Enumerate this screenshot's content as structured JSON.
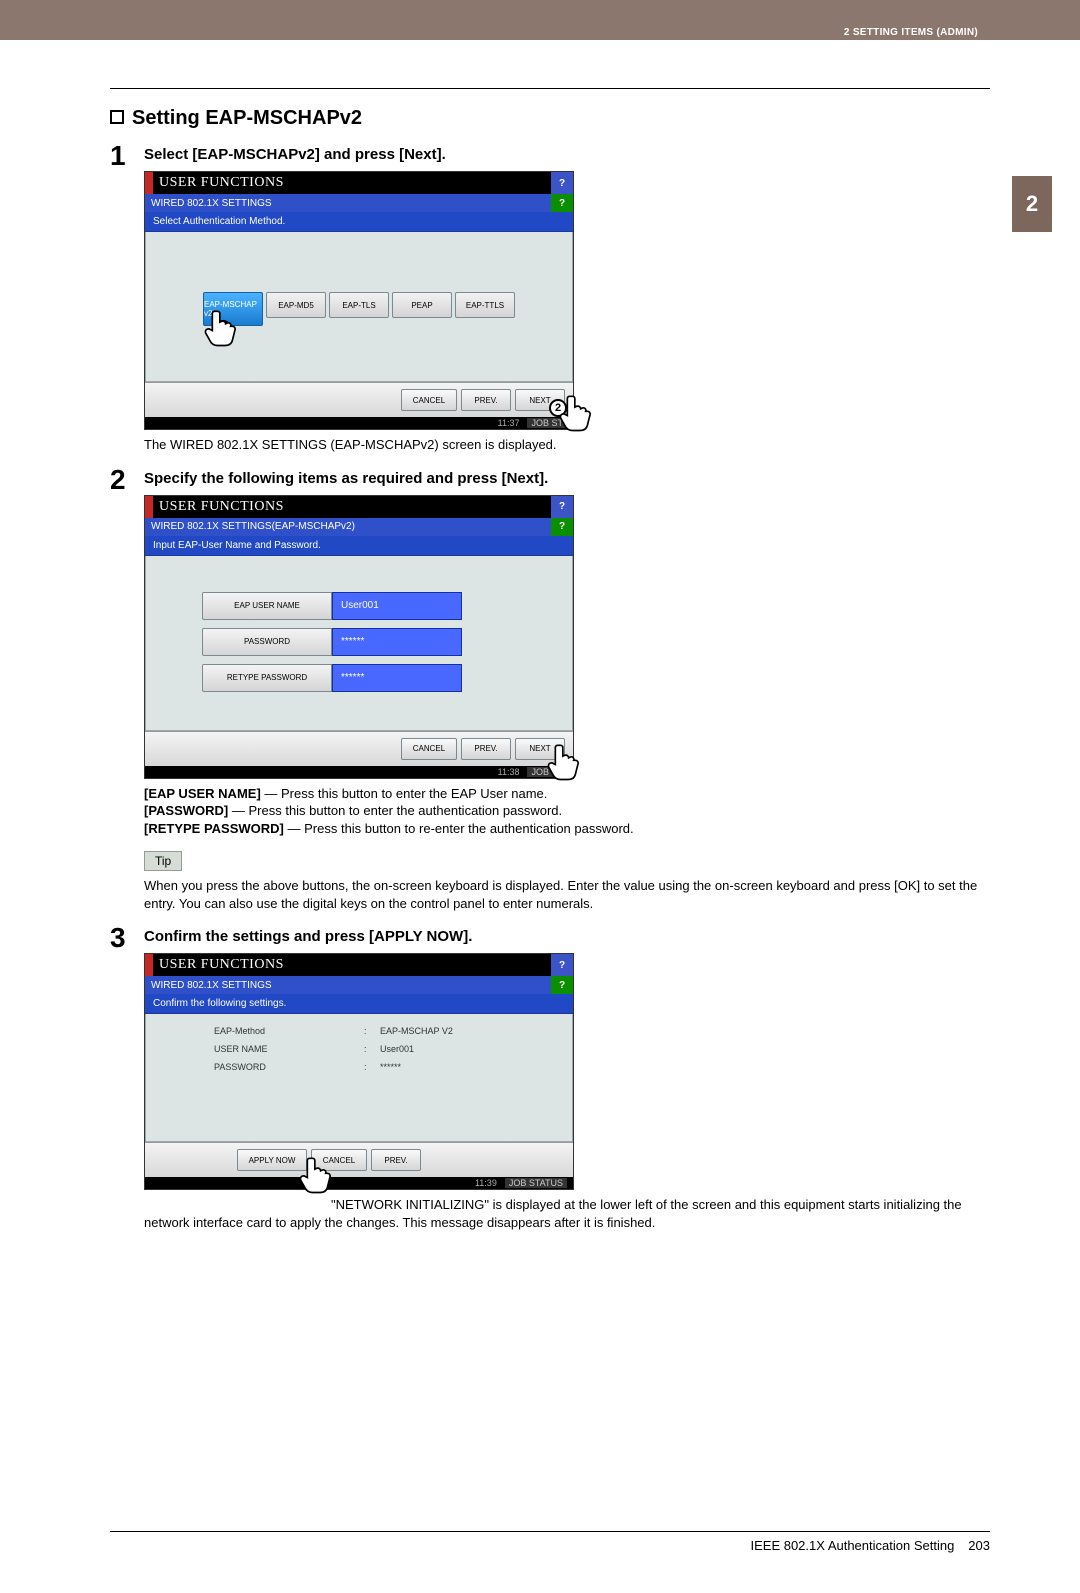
{
  "header": {
    "breadcrumb": "2 SETTING ITEMS (ADMIN)"
  },
  "side_tab": "2",
  "section_title": "Setting EAP-MSCHAPv2",
  "steps": [
    {
      "num": "1",
      "head": "Select [EAP-MSCHAPv2] and press [Next].",
      "after_text": "The WIRED 802.1X SETTINGS (EAP-MSCHAPv2) screen is displayed."
    },
    {
      "num": "2",
      "head": "Specify the following items as required and press [Next].",
      "field_desc": [
        {
          "label": "[EAP USER NAME]",
          "text": " — Press this button to enter the EAP User name."
        },
        {
          "label": "[PASSWORD]",
          "text": " — Press this button to enter the authentication password."
        },
        {
          "label": "[RETYPE PASSWORD]",
          "text": " — Press this button to re-enter the authentication password."
        }
      ],
      "tip_label": "Tip",
      "tip_text": "When you press the above buttons, the on-screen keyboard is displayed. Enter the value using the on-screen keyboard and press [OK] to set the entry. You can also use the digital keys on the control panel to enter numerals."
    },
    {
      "num": "3",
      "head": "Confirm the settings and press [APPLY NOW].",
      "after_text": "\"NETWORK INITIALIZING\" is displayed at the lower left of the screen and this equipment starts initializing the network interface card to apply the changes. This message disappears after it is finished."
    }
  ],
  "screen1": {
    "title": "USER FUNCTIONS",
    "subtitle": "WIRED 802.1X SETTINGS",
    "hint": "Select Authentication Method.",
    "buttons": [
      "EAP-MSCHAP v2",
      "EAP-MD5",
      "EAP-TLS",
      "PEAP",
      "EAP-TTLS"
    ],
    "bottom": [
      "CANCEL",
      "PREV.",
      "NEXT"
    ],
    "time": "11:37",
    "job": "JOB ST"
  },
  "screen2": {
    "title": "USER FUNCTIONS",
    "subtitle": "WIRED 802.1X SETTINGS(EAP-MSCHAPv2)",
    "hint": "Input EAP-User Name and Password.",
    "rows": [
      {
        "label": "EAP USER NAME",
        "value": "User001"
      },
      {
        "label": "PASSWORD",
        "value": "******"
      },
      {
        "label": "RETYPE PASSWORD",
        "value": "******"
      }
    ],
    "bottom": [
      "CANCEL",
      "PREV.",
      "NEXT"
    ],
    "time": "11:38",
    "job": "JOB ST"
  },
  "screen3": {
    "title": "USER FUNCTIONS",
    "subtitle": "WIRED 802.1X SETTINGS",
    "hint": "Confirm the following settings.",
    "rows": [
      {
        "label": "EAP-Method",
        "value": "EAP-MSCHAP V2"
      },
      {
        "label": "USER NAME",
        "value": "User001"
      },
      {
        "label": "PASSWORD",
        "value": "******"
      }
    ],
    "bottom": [
      "APPLY NOW",
      "CANCEL",
      "PREV."
    ],
    "time": "11:39",
    "job": "JOB STATUS"
  },
  "footer": {
    "section": "IEEE 802.1X Authentication Setting",
    "page": "203"
  }
}
